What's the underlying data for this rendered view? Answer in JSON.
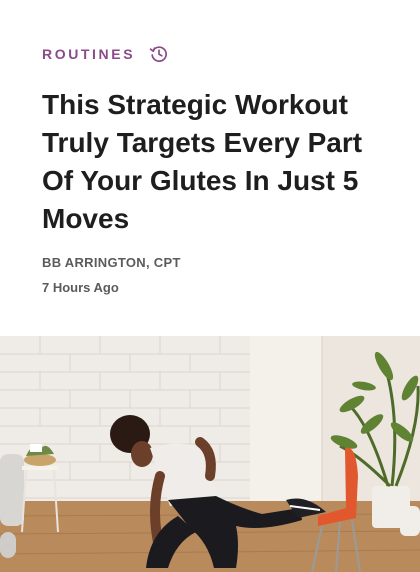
{
  "article": {
    "category": "ROUTINES",
    "category_icon": "history-icon",
    "title": "This Strategic Workout Truly Targets Every Part Of Your Glutes In Just 5 Moves",
    "author": "BB ARRINGTON, CPT",
    "timestamp": "7 Hours Ago"
  },
  "colors": {
    "accent": "#8b4a8a",
    "title": "#1e1e1e",
    "meta": "#5b5b5b"
  },
  "hero_image": {
    "subject": "woman-lunge-with-dumbbell-photo"
  }
}
